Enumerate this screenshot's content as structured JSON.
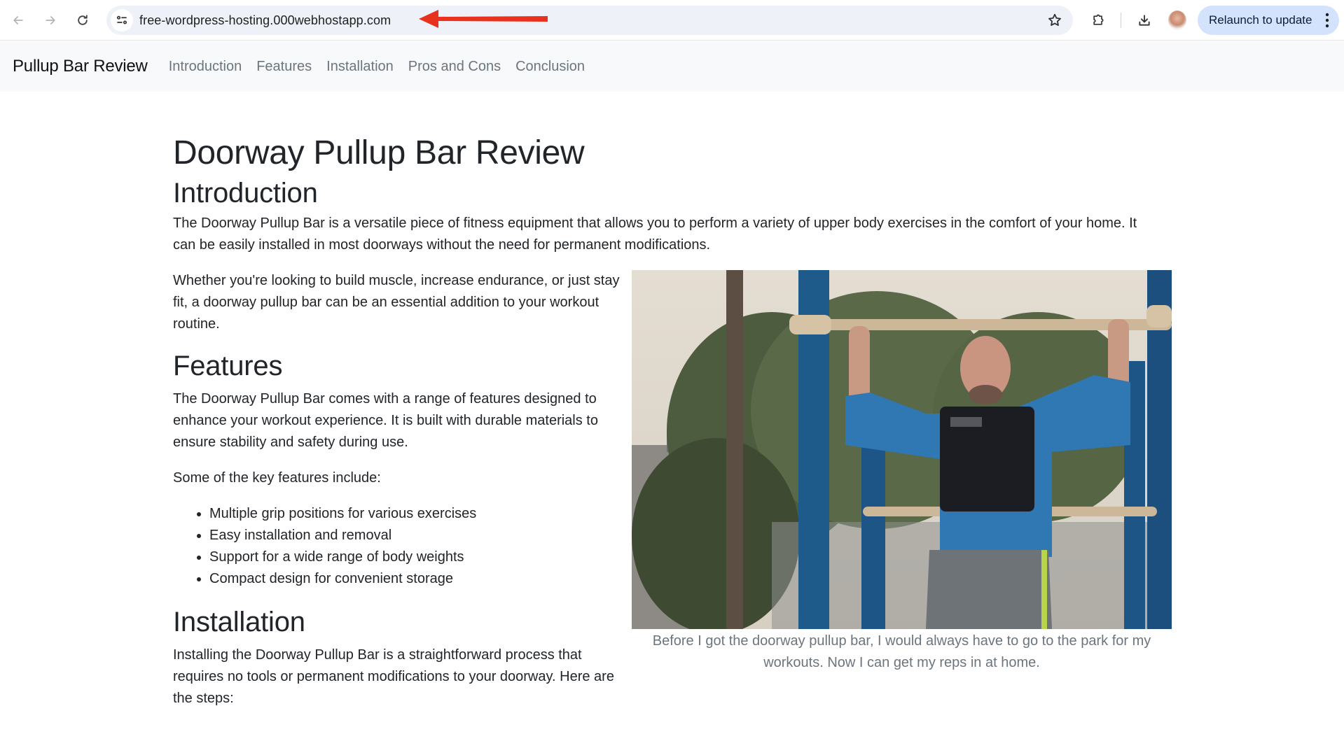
{
  "browser": {
    "url": "free-wordpress-hosting.000webhostapp.com",
    "relaunch_label": "Relaunch to update",
    "icons": [
      "back-arrow-icon",
      "forward-arrow-icon",
      "reload-icon",
      "site-info-icon",
      "bookmark-star-icon",
      "extensions-puzzle-icon",
      "download-icon",
      "profile-avatar",
      "more-vert-icon"
    ],
    "annotation": {
      "type": "arrow",
      "color": "#e8321e",
      "points_to": "url"
    }
  },
  "navbar": {
    "brand": "Pullup Bar Review",
    "links": [
      {
        "label": "Introduction"
      },
      {
        "label": "Features"
      },
      {
        "label": "Installation"
      },
      {
        "label": "Pros and Cons"
      },
      {
        "label": "Conclusion"
      }
    ]
  },
  "article": {
    "title": "Doorway Pullup Bar Review",
    "introduction": {
      "heading": "Introduction",
      "paragraph1": "The Doorway Pullup Bar is a versatile piece of fitness equipment that allows you to perform a variety of upper body exercises in the comfort of your home. It can be easily installed in most doorways without the need for permanent modifications.",
      "paragraph2": "Whether you're looking to build muscle, increase endurance, or just stay fit, a doorway pullup bar can be an essential addition to your workout routine."
    },
    "features": {
      "heading": "Features",
      "paragraph1": "The Doorway Pullup Bar comes with a range of features designed to enhance your workout experience. It is built with durable materials to ensure stability and safety during use.",
      "paragraph2": "Some of the key features include:",
      "items": [
        "Multiple grip positions for various exercises",
        "Easy installation and removal",
        "Support for a wide range of body weights",
        "Compact design for convenient storage"
      ]
    },
    "installation": {
      "heading": "Installation",
      "paragraph1": "Installing the Doorway Pullup Bar is a straightforward process that requires no tools or permanent modifications to your doorway. Here are the steps:"
    },
    "figure": {
      "image_description": "Man in blue sweatshirt and black weighted vest hanging from a pullup bar at an outdoor park",
      "caption": "Before I got the doorway pullup bar, I would always have to go to the park for my workouts. Now I can get my reps in at home."
    }
  },
  "colors": {
    "navbar_bg": "#f8f9fa",
    "nav_link": "#6c757d",
    "text": "#212529",
    "relaunch_bg": "#d3e3fd",
    "omnibox_bg": "#eef1f8",
    "annotation_red": "#e8321e"
  }
}
